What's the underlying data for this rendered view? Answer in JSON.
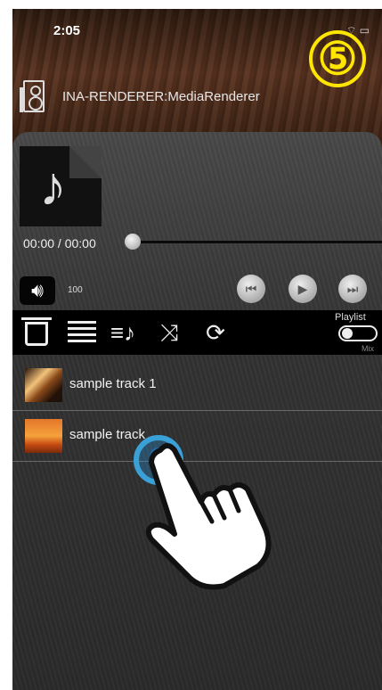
{
  "status": {
    "time": "2:05",
    "icons": "wifi-icon battery-icon"
  },
  "annotation": {
    "step": "⑤"
  },
  "renderer": {
    "name": "INA-RENDERER:MediaRenderer",
    "icon": "speaker-icon"
  },
  "now_playing": {
    "art_icon": "music-note-icon",
    "time_display": "00:00 / 00:00",
    "seek_fraction": 0
  },
  "volume": {
    "value": "100",
    "icon": "speaker-volume-icon"
  },
  "transport": {
    "prev": "previous-icon",
    "play": "play-icon",
    "next": "next-icon"
  },
  "toolbar": {
    "items": [
      "trash-icon",
      "list-icon",
      "queue-music-icon",
      "shuffle-icon",
      "repeat-icon"
    ],
    "playlist_label": "Playlist",
    "mix_label": "Mix"
  },
  "tracks": [
    {
      "title": "sample track 1"
    },
    {
      "title": "sample track"
    }
  ],
  "colors": {
    "tap_highlight": "#3aa0d8",
    "annotation": "#ffe600"
  }
}
